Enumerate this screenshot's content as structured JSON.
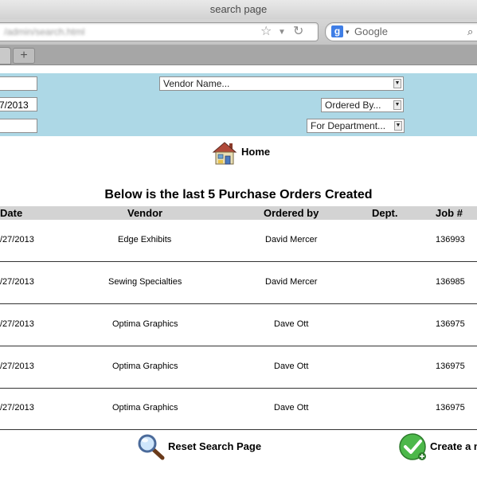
{
  "window": {
    "title": "search page"
  },
  "browser": {
    "url": "/admin/search.html",
    "search_placeholder": "Google",
    "new_tab_label": "+"
  },
  "form": {
    "field1_value": "",
    "field2_value": "7/2013",
    "field3_value": "",
    "vendor_select": "Vendor Name...",
    "ordered_by_select": "Ordered By...",
    "department_select": "For Department..."
  },
  "nav": {
    "home_label": "Home"
  },
  "table": {
    "title": "Below is the last 5 Purchase Orders Created",
    "headers": {
      "date": "Date",
      "vendor": "Vendor",
      "ordered_by": "Ordered by",
      "dept": "Dept.",
      "job": "Job #"
    },
    "rows": [
      {
        "date": "/27/2013",
        "vendor": "Edge Exhibits",
        "ordered_by": "David Mercer",
        "dept": "",
        "job": "136993"
      },
      {
        "date": "/27/2013",
        "vendor": "Sewing Specialties",
        "ordered_by": "David Mercer",
        "dept": "",
        "job": "136985"
      },
      {
        "date": "/27/2013",
        "vendor": "Optima Graphics",
        "ordered_by": "Dave Ott",
        "dept": "",
        "job": "136975"
      },
      {
        "date": "/27/2013",
        "vendor": "Optima Graphics",
        "ordered_by": "Dave Ott",
        "dept": "",
        "job": "136975"
      },
      {
        "date": "/27/2013",
        "vendor": "Optima Graphics",
        "ordered_by": "Dave Ott",
        "dept": "",
        "job": "136975"
      }
    ]
  },
  "actions": {
    "reset_label": "Reset Search Page",
    "create_label": "Create a n"
  },
  "colors": {
    "form_band": "#add8e6",
    "table_header": "#d3d3d3"
  }
}
